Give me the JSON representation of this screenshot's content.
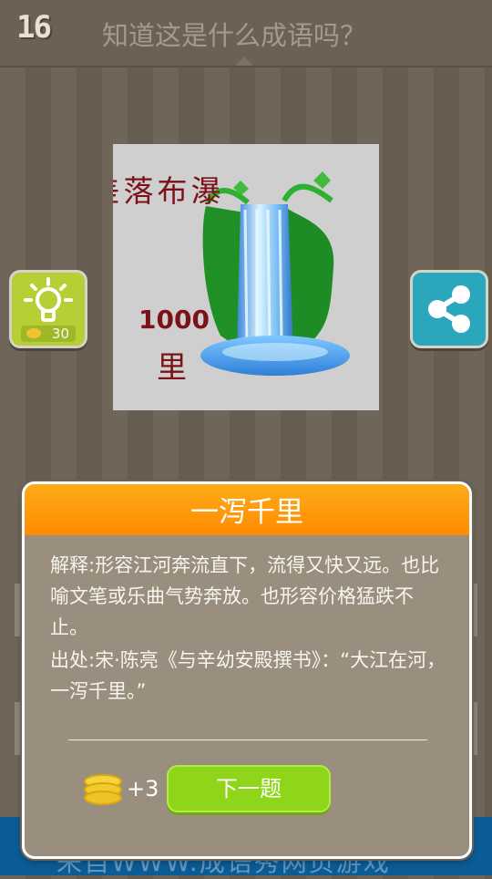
{
  "header": {
    "level": "16",
    "question": "知道这是什么成语吗？"
  },
  "puzzle": {
    "text_lines": [
      "瀑",
      "布",
      "落",
      "差"
    ],
    "number": "1000",
    "unit": "里"
  },
  "hint": {
    "cost": "30",
    "icon": "lightbulb-icon"
  },
  "share": {
    "icon": "share-icon"
  },
  "modal": {
    "title": "一泻千里",
    "explanation_label": "解释:",
    "explanation_text": "形容江河奔流直下，流得又快又远。也比喻文笔或乐曲气势奔放。也形容价格猛跌不止。",
    "source_label": "出处:",
    "source_text": "宋·陈亮《与辛幼安殿撰书》：“大江在河，一泻千里。”",
    "reward": "+3",
    "next_button": "下一题"
  },
  "footer": {
    "text": "来自WWW.成语秀网页游戏"
  }
}
